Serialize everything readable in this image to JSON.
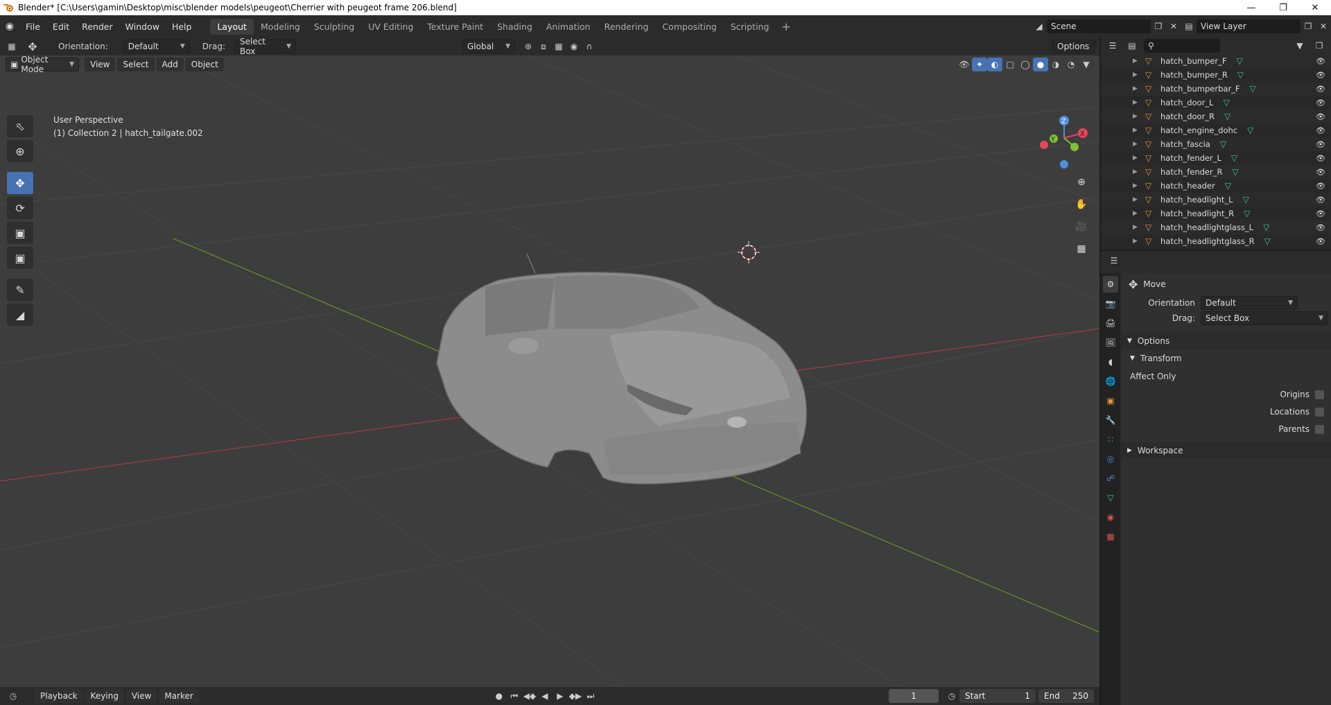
{
  "window": {
    "title": "Blender* [C:\\Users\\gamin\\Desktop\\misc\\blender models\\peugeot\\Cherrier with peugeot frame 206.blend]"
  },
  "menu": {
    "items": [
      "File",
      "Edit",
      "Render",
      "Window",
      "Help"
    ]
  },
  "workspaces": {
    "tabs": [
      "Layout",
      "Modeling",
      "Sculpting",
      "UV Editing",
      "Texture Paint",
      "Shading",
      "Animation",
      "Rendering",
      "Compositing",
      "Scripting"
    ],
    "active": "Layout"
  },
  "scene": {
    "name": "Scene",
    "view_layer": "View Layer"
  },
  "tool_header": {
    "orientation_label": "Orientation:",
    "orientation_value": "Default",
    "drag_label": "Drag:",
    "drag_value": "Select Box",
    "transform_space": "Global",
    "options_label": "Options"
  },
  "viewport_header": {
    "mode": "Object Mode",
    "menus": [
      "View",
      "Select",
      "Add",
      "Object"
    ]
  },
  "viewport": {
    "perspective": "User Perspective",
    "context": "(1) Collection 2 | hatch_tailgate.002",
    "gizmo_axes": {
      "x": "X",
      "y": "Y",
      "z": "Z"
    }
  },
  "outliner": {
    "items": [
      "hatch_bumper_F",
      "hatch_bumper_R",
      "hatch_bumperbar_F",
      "hatch_door_L",
      "hatch_door_R",
      "hatch_engine_dohc",
      "hatch_fascia",
      "hatch_fender_L",
      "hatch_fender_R",
      "hatch_header",
      "hatch_headlight_L",
      "hatch_headlight_R",
      "hatch_headlightglass_L",
      "hatch_headlightglass_R"
    ]
  },
  "properties": {
    "tool_name": "Move",
    "orientation_label": "Orientation",
    "orientation_value": "Default",
    "drag_label": "Drag:",
    "drag_value": "Select Box",
    "options_panel": "Options",
    "transform_subpanel": "Transform",
    "affect_only": "Affect Only",
    "origins": "Origins",
    "locations": "Locations",
    "parents": "Parents",
    "workspace_panel": "Workspace"
  },
  "timeline": {
    "menus": [
      "Playback",
      "Keying",
      "View",
      "Marker"
    ],
    "current_frame": "1",
    "start_label": "Start",
    "start_value": "1",
    "end_label": "End",
    "end_value": "250"
  },
  "colors": {
    "accent": "#4772b3",
    "x_axis": "#e5465a",
    "y_axis": "#7fbf35",
    "z_axis": "#4f8fe3",
    "object_icon": "#e8953a",
    "mesh_icon": "#38c9a0"
  }
}
